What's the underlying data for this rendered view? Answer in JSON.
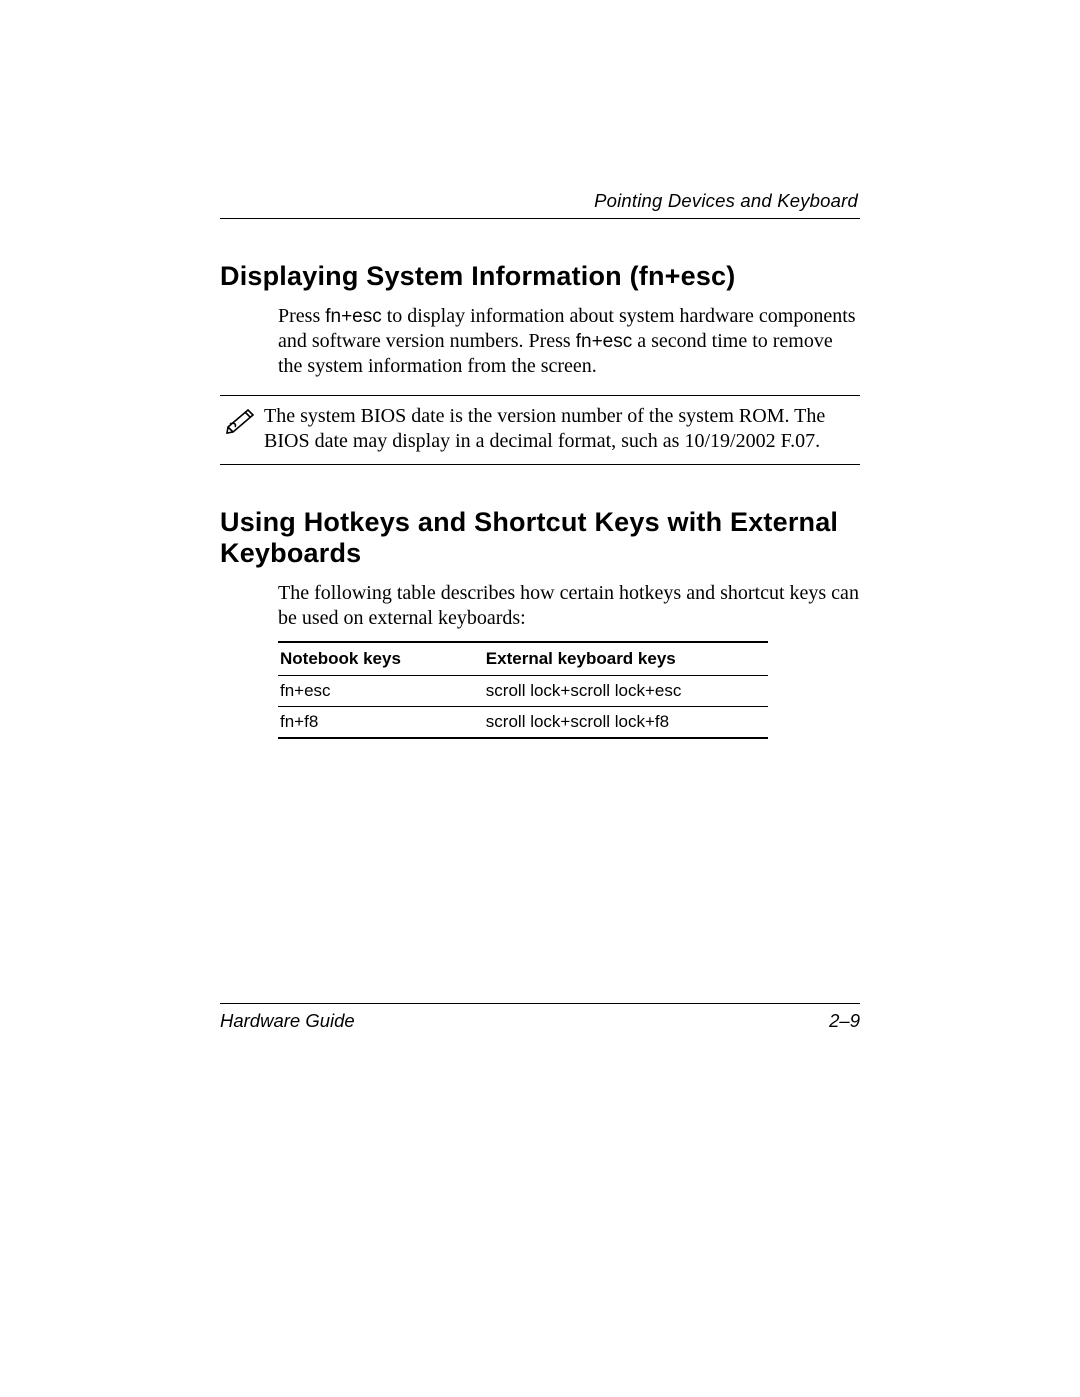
{
  "header": {
    "running_title": "Pointing Devices and Keyboard"
  },
  "section1": {
    "heading": "Displaying System Information (fn+esc)",
    "para_pre1": "Press ",
    "key1": "fn+esc",
    "para_mid1": " to display information about system hardware components and software version numbers. Press ",
    "key2": "fn+esc",
    "para_post1": " a second time to remove the system information from the screen.",
    "note": "The system BIOS date is the version number of the system ROM. The BIOS date may display in a decimal format, such as 10/19/2002 F.07."
  },
  "section2": {
    "heading": "Using Hotkeys and Shortcut Keys with External Keyboards",
    "intro": "The following table describes how certain hotkeys and shortcut keys can be used on external keyboards:",
    "table": {
      "col1": "Notebook keys",
      "col2": "External keyboard keys",
      "rows": [
        {
          "notebook": "fn+esc",
          "external": "scroll lock+scroll lock+esc"
        },
        {
          "notebook": "fn+f8",
          "external": "scroll lock+scroll lock+f8"
        }
      ]
    }
  },
  "footer": {
    "guide": "Hardware Guide",
    "page": "2–9"
  }
}
